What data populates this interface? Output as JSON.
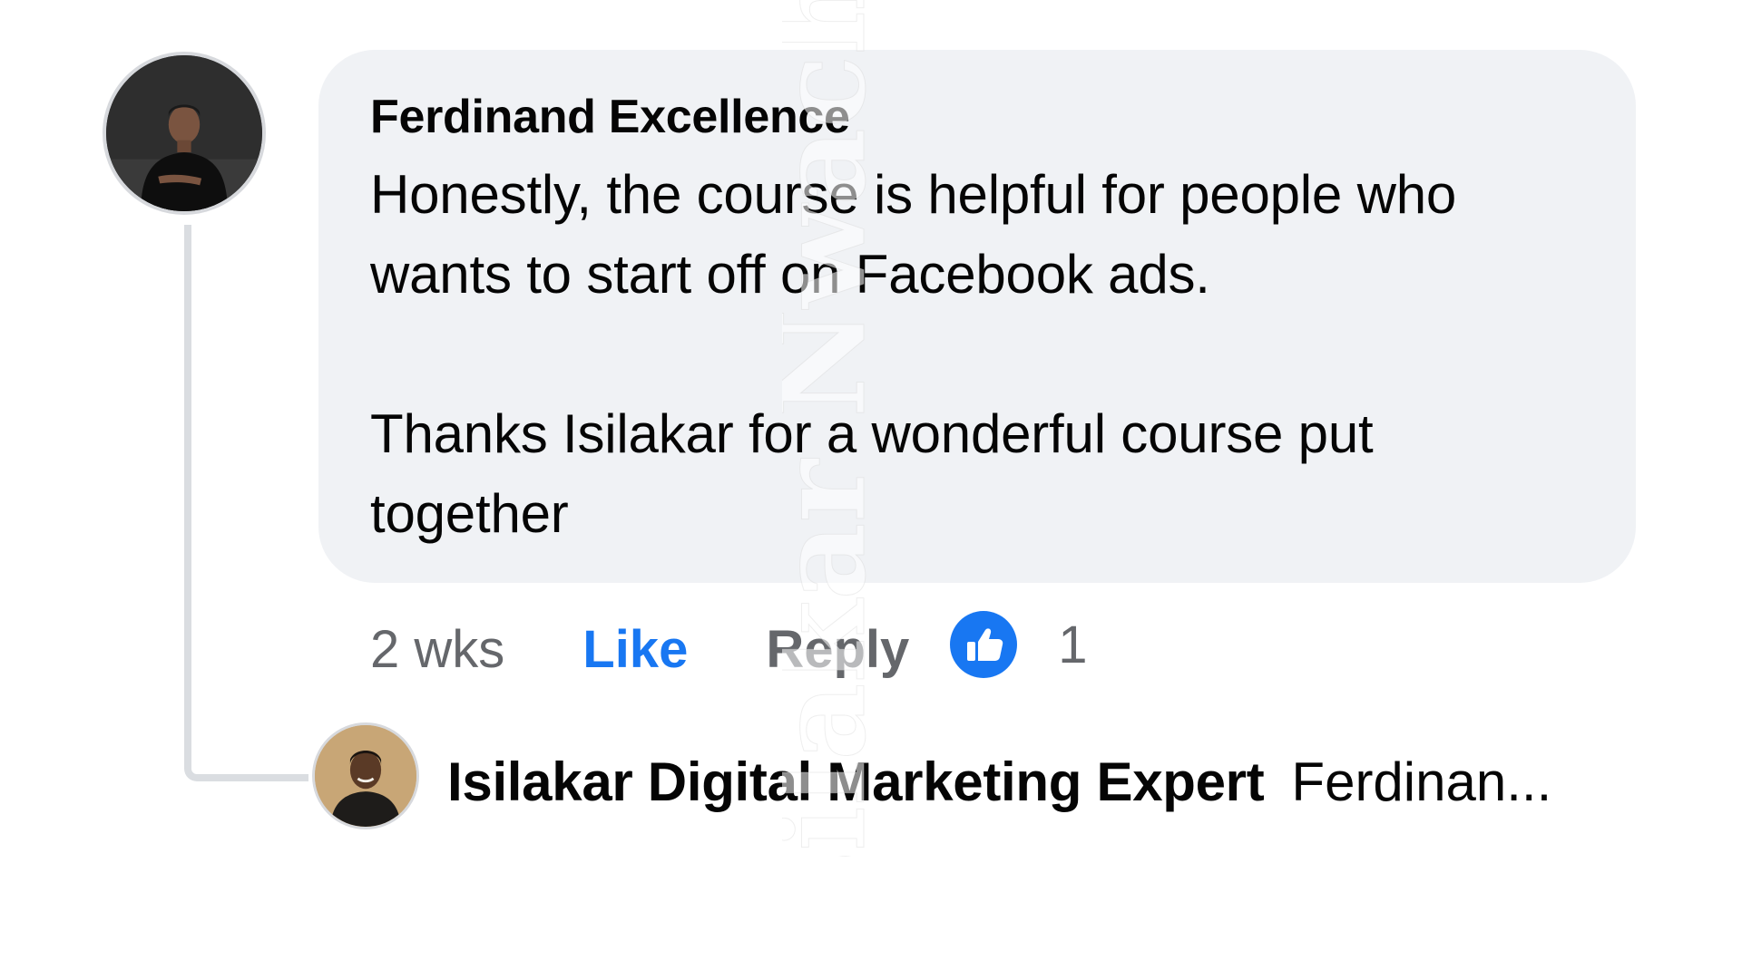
{
  "comment": {
    "author": "Ferdinand Excellence",
    "text": "Honestly, the course is helpful for people who\nwants to start off on Facebook ads.\n\nThanks Isilakar for a wonderful course put\ntogether",
    "time": "2 wks",
    "like_label": "Like",
    "reply_label": "Reply",
    "reaction_count": "1"
  },
  "reply": {
    "author": "Isilakar Digital Marketing Expert",
    "preview": "Ferdinan..."
  },
  "watermark": {
    "text": "Isilakar Nwachu"
  },
  "colors": {
    "bubble": "#f0f2f5",
    "like_blue": "#1877f2",
    "secondary_text": "#65676b",
    "primary_text": "#050505"
  }
}
